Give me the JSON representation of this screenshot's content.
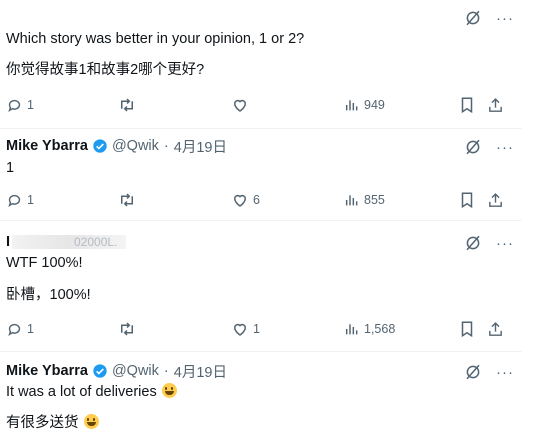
{
  "tweets": [
    {
      "text_lines": [
        "Which story was better in your opinion, 1 or 2?",
        "你觉得故事1和故事2哪个更好?"
      ],
      "actions": {
        "replies": "1",
        "reposts": "",
        "likes": "",
        "views": "949"
      }
    },
    {
      "author": "Mike Ybarra",
      "handle": "@Qwik",
      "separator": "·",
      "date": "4月19日",
      "text_lines": [
        "1"
      ],
      "actions": {
        "replies": "1",
        "reposts": "",
        "likes": "6",
        "views": "855"
      }
    },
    {
      "author_partial": "I",
      "handle_partial": "02000L.",
      "text_lines": [
        "WTF 100%!",
        "卧槽，100%!"
      ],
      "actions": {
        "replies": "1",
        "reposts": "",
        "likes": "1",
        "views": "1,568"
      }
    },
    {
      "author": "Mike Ybarra",
      "handle": "@Qwik",
      "separator": "·",
      "date": "4月19日",
      "text_lines": [
        "It was a lot of deliveries",
        "有很多送货"
      ]
    }
  ],
  "menu_label": "···",
  "icons": {
    "grok": "grok-icon",
    "more": "more-icon",
    "reply": "reply-icon",
    "repost": "repost-icon",
    "like": "like-icon",
    "views": "views-icon",
    "bookmark": "bookmark-icon",
    "share": "share-icon",
    "verified": "verified-badge-icon",
    "emoji": "grinning-emoji"
  },
  "colors": {
    "text": "#0f1419",
    "secondary": "#536471",
    "verified": "#1d9bf0",
    "divider": "#eff3f4"
  }
}
